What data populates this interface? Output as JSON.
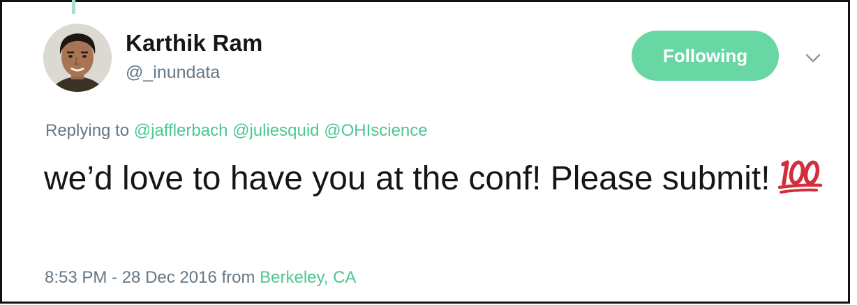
{
  "author": {
    "name": "Karthik Ram",
    "handle": "@_inundata",
    "avatar_icon": "profile-photo"
  },
  "follow_button": {
    "label": "Following",
    "color": "#69d7a4"
  },
  "menu_icon": "chevron-down-icon",
  "reply": {
    "prefix": "Replying to",
    "mentions": [
      "@jafflerbach",
      "@juliesquid",
      "@OHIscience"
    ]
  },
  "tweet": {
    "text": "we’d love to have you at the conf! Please submit!",
    "emoji": "💯"
  },
  "meta": {
    "timestamp": "8:53 PM - 28 Dec 2016",
    "from_label": "from",
    "location": "Berkeley, CA"
  },
  "colors": {
    "accent": "#4dc691",
    "muted": "#657786",
    "text": "#14171a"
  }
}
